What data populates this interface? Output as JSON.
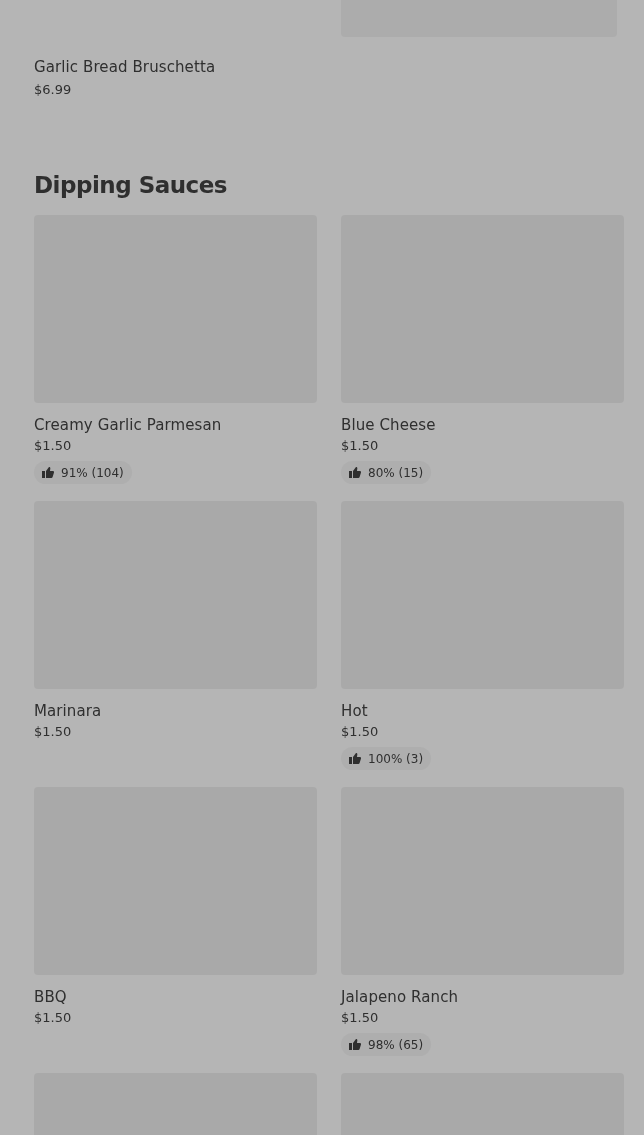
{
  "previous_section": {
    "items": [
      {
        "kind": "text",
        "name": "Garlic Bread Bruschetta",
        "price": "$6.99"
      },
      {
        "kind": "image"
      }
    ]
  },
  "section": {
    "title": "Dipping Sauces",
    "items": [
      {
        "kind": "card",
        "name": "Creamy Garlic Parmesan",
        "price": "$1.50",
        "rating": "91% (104)"
      },
      {
        "kind": "card",
        "name": "Blue Cheese",
        "price": "$1.50",
        "rating": "80% (15)"
      },
      {
        "kind": "card",
        "name": "Marinara",
        "price": "$1.50"
      },
      {
        "kind": "card",
        "name": "Hot",
        "price": "$1.50",
        "rating": "100% (3)"
      },
      {
        "kind": "card",
        "name": "BBQ",
        "price": "$1.50"
      },
      {
        "kind": "card",
        "name": "Jalapeno Ranch",
        "price": "$1.50",
        "rating": "98% (65)"
      },
      {
        "kind": "image"
      },
      {
        "kind": "image"
      }
    ]
  }
}
